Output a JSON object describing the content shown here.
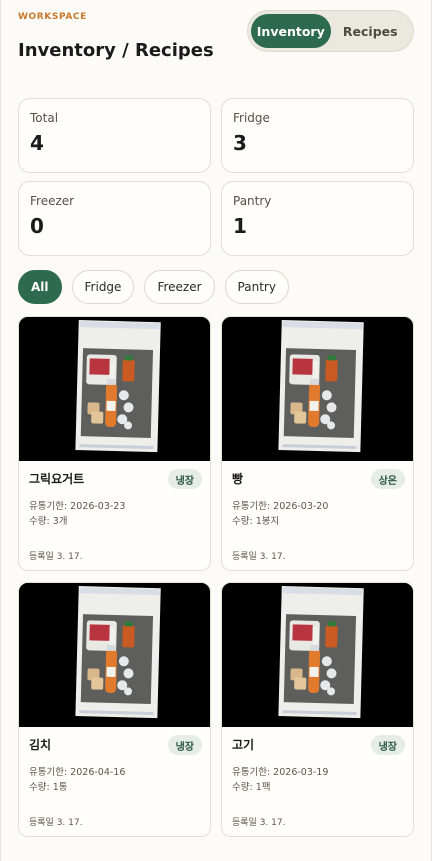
{
  "header": {
    "eyebrow": "WORKSPACE",
    "title": "Inventory / Recipes"
  },
  "view_toggle": {
    "options": [
      {
        "label": "Inventory",
        "active": true
      },
      {
        "label": "Recipes",
        "active": false
      }
    ]
  },
  "stats": [
    {
      "label": "Total",
      "value": "4"
    },
    {
      "label": "Fridge",
      "value": "3"
    },
    {
      "label": "Freezer",
      "value": "0"
    },
    {
      "label": "Pantry",
      "value": "1"
    }
  ],
  "filters": [
    {
      "label": "All",
      "active": true
    },
    {
      "label": "Fridge",
      "active": false
    },
    {
      "label": "Freezer",
      "active": false
    },
    {
      "label": "Pantry",
      "active": false
    }
  ],
  "items": [
    {
      "name": "그릭요거트",
      "badge": "냉장",
      "expiry": "유통기한: 2026-03-23",
      "quantity": "수량: 3개",
      "registered": "등록일 3. 17."
    },
    {
      "name": "빵",
      "badge": "상온",
      "expiry": "유통기한: 2026-03-20",
      "quantity": "수량: 1봉지",
      "registered": "등록일 3. 17."
    },
    {
      "name": "김치",
      "badge": "냉장",
      "expiry": "유통기한: 2026-04-16",
      "quantity": "수량: 1통",
      "registered": "등록일 3. 17."
    },
    {
      "name": "고기",
      "badge": "냉장",
      "expiry": "유통기한: 2026-03-19",
      "quantity": "수량: 1팩",
      "registered": "등록일 3. 17."
    }
  ],
  "colors": {
    "accent": "#2e6a4f",
    "eyebrow": "#c9782b",
    "badge_bg": "#e6ece7"
  }
}
